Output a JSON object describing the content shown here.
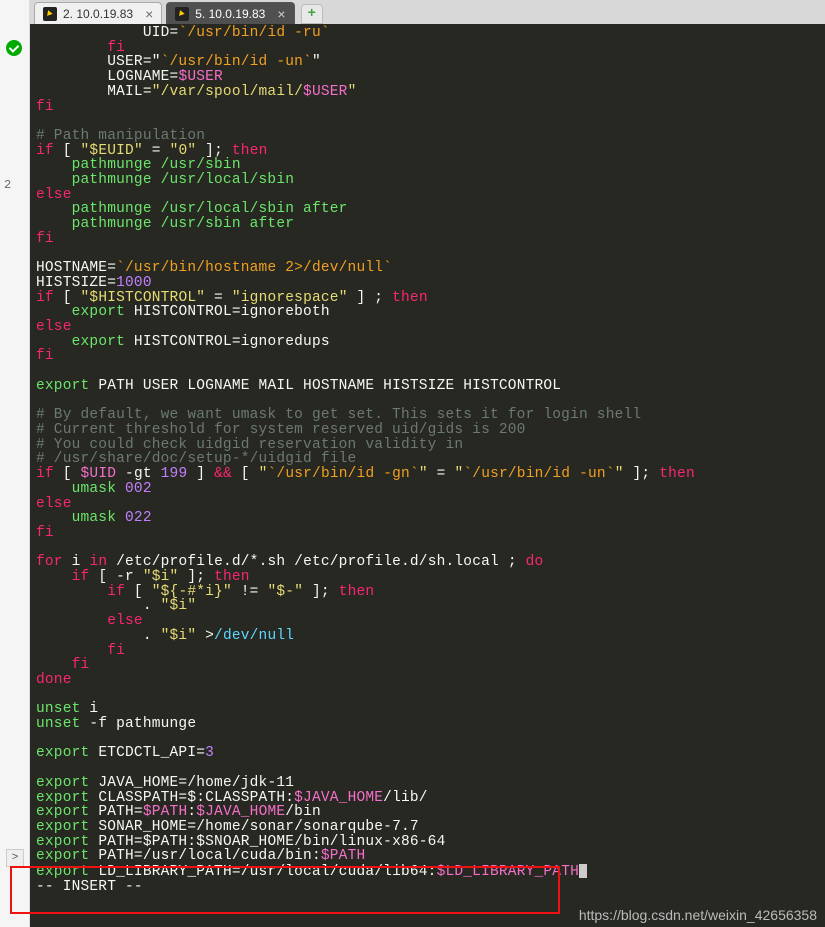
{
  "tabs": [
    {
      "label": "2. 10.0.19.83",
      "active": false
    },
    {
      "label": "5. 10.0.19.83",
      "active": true
    }
  ],
  "gutter": {
    "label2": "2"
  },
  "watermark": "https://blog.csdn.net/weixin_42656358",
  "code": {
    "l01a": "            UID=",
    "l01b": "`/usr/bin/id -ru`",
    "l02": "        fi",
    "l03a": "        USER=\"",
    "l03b": "`/usr/bin/id -un`",
    "l03c": "\"",
    "l04a": "        LOGNAME=",
    "l04b": "$USER",
    "l05a": "        MAIL=",
    "l05b": "\"/var/spool/mail/",
    "l05c": "$USER",
    "l05d": "\"",
    "l06": "fi",
    "l07": "",
    "l08": "# Path manipulation",
    "l09a": "if",
    "l09b": " [ ",
    "l09c": "\"$EUID\"",
    "l09d": " = ",
    "l09e": "\"0\"",
    "l09f": " ]; ",
    "l09g": "then",
    "l10": "    pathmunge /usr/sbin",
    "l11": "    pathmunge /usr/local/sbin",
    "l12": "else",
    "l13": "    pathmunge /usr/local/sbin after",
    "l14": "    pathmunge /usr/sbin after",
    "l15": "fi",
    "l16": "",
    "l17a": "HOSTNAME=",
    "l17b": "`/usr/bin/hostname 2>/dev/null`",
    "l18a": "HISTSIZE=",
    "l18b": "1000",
    "l19a": "if",
    "l19b": " [ ",
    "l19c": "\"$HISTCONTROL\"",
    "l19d": " = ",
    "l19e": "\"ignorespace\"",
    "l19f": " ] ; ",
    "l19g": "then",
    "l20a": "    ",
    "l20b": "export",
    "l20c": " HISTCONTROL=ignoreboth",
    "l21": "else",
    "l22a": "    ",
    "l22b": "export",
    "l22c": " HISTCONTROL=ignoredups",
    "l23": "fi",
    "l24": "",
    "l25a": "export",
    "l25b": " PATH USER LOGNAME MAIL HOSTNAME HISTSIZE HISTCONTROL",
    "l26": "",
    "l27": "# By default, we want umask to get set. This sets it for login shell",
    "l28": "# Current threshold for system reserved uid/gids is 200",
    "l29": "# You could check uidgid reservation validity in",
    "l30": "# /usr/share/doc/setup-*/uidgid file",
    "l31a": "if",
    "l31b": " [ ",
    "l31c": "$UID",
    "l31d": " -gt ",
    "l31e": "199",
    "l31f": " ] ",
    "l31g": "&&",
    "l31h": " [ ",
    "l31i": "\"",
    "l31j": "`/usr/bin/id -gn`",
    "l31k": "\"",
    "l31l": " = ",
    "l31m": "\"",
    "l31n": "`/usr/bin/id -un`",
    "l31o": "\"",
    "l31p": " ]; ",
    "l31q": "then",
    "l32a": "    umask ",
    "l32b": "002",
    "l33": "else",
    "l34a": "    umask ",
    "l34b": "022",
    "l35": "fi",
    "l36": "",
    "l37a": "for",
    "l37b": " i ",
    "l37c": "in",
    "l37d": " /etc/profile.d/*.sh /etc/profile.d/sh.local ; ",
    "l37e": "do",
    "l38a": "    ",
    "l38b": "if",
    "l38c": " [ -r ",
    "l38d": "\"$i\"",
    "l38e": " ]; ",
    "l38f": "then",
    "l39a": "        ",
    "l39b": "if",
    "l39c": " [ ",
    "l39d": "\"${-#*i}\"",
    "l39e": " != ",
    "l39f": "\"$-\"",
    "l39g": " ]; ",
    "l39h": "then",
    "l40a": "            . ",
    "l40b": "\"$i\"",
    "l41": "        else",
    "l42a": "            . ",
    "l42b": "\"$i\"",
    "l42c": " >",
    "l42d": "/dev/null",
    "l43": "        fi",
    "l44": "    fi",
    "l45": "done",
    "l46": "",
    "l47a": "unset",
    "l47b": " i",
    "l48a": "unset",
    "l48b": " -f pathmunge",
    "l49": "",
    "l50a": "export",
    "l50b": " ETCDCTL_API=",
    "l50c": "3",
    "l51": "",
    "l52a": "export",
    "l52b": " JAVA_HOME=/home/jdk-11",
    "l53a": "export",
    "l53b": " CLASSPATH=$:CLASSPATH:",
    "l53c": "$JAVA_HOME",
    "l53d": "/lib/",
    "l54a": "export",
    "l54b": " PATH=",
    "l54c": "$PATH",
    "l54d": ":",
    "l54e": "$JAVA_HOME",
    "l54f": "/bin",
    "l55a": "export",
    "l55b": " SONAR_HOME=/home/sonar/sonarqube-7.7",
    "l56a": "export",
    "l56b": " PATH=$PATH:$SNOAR_HOME/bin/linux-x86-64",
    "l57a": "export",
    "l57b": " PATH=/usr/local/cuda/bin:",
    "l57c": "$PATH",
    "l58a": "export",
    "l58b": " LD_LIBRARY_PATH=/usr/local/cuda/lib64:",
    "l58c": "$LD_LIBRARY_PATH",
    "l59": "-- INSERT --"
  }
}
